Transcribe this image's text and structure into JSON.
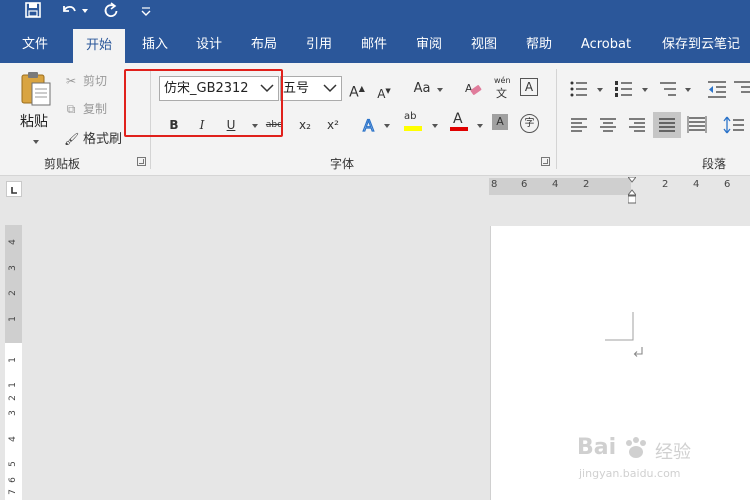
{
  "tabs": [
    "文件",
    "开始",
    "插入",
    "设计",
    "布局",
    "引用",
    "邮件",
    "审阅",
    "视图",
    "帮助",
    "Acrobat",
    "保存到云笔记"
  ],
  "active_tab": "开始",
  "clipboard": {
    "paste_label": "粘贴",
    "cut_label": "剪切",
    "copy_label": "复制",
    "format_painter_label": "格式刷",
    "group_label": "剪贴板"
  },
  "font": {
    "font_name": "仿宋_GB2312",
    "font_size": "五号",
    "group_label": "字体",
    "bold": "B",
    "italic": "I",
    "underline": "U",
    "strikethrough": "abc",
    "subscript": "x₂",
    "superscript": "x²",
    "change_case": "Aa",
    "grow": "A",
    "shrink": "A",
    "phonetic_top": "wén",
    "phonetic_bottom": "文",
    "font_color_letter": "A",
    "shading_letter": "A",
    "enclose_char": "字",
    "border_char": "A",
    "highlight_label": "ab"
  },
  "paragraph": {
    "group_label": "段落"
  },
  "ruler": {
    "h_ticks": [
      "8",
      "6",
      "4",
      "2",
      "2",
      "4",
      "6"
    ],
    "v_ticks": [
      "4",
      "3",
      "2",
      "1",
      "1",
      "1",
      "2",
      "3",
      "4",
      "5",
      "6",
      "7"
    ]
  },
  "watermark": {
    "brand": "Bai",
    "brand_cn": "经验",
    "url": "jingyan.baidu.com"
  },
  "colors": {
    "ribbon_blue": "#2b579a",
    "highlight_red": "#e0201b",
    "font_color_bar": "#e00000",
    "highlight_yellow": "#ffff00"
  }
}
